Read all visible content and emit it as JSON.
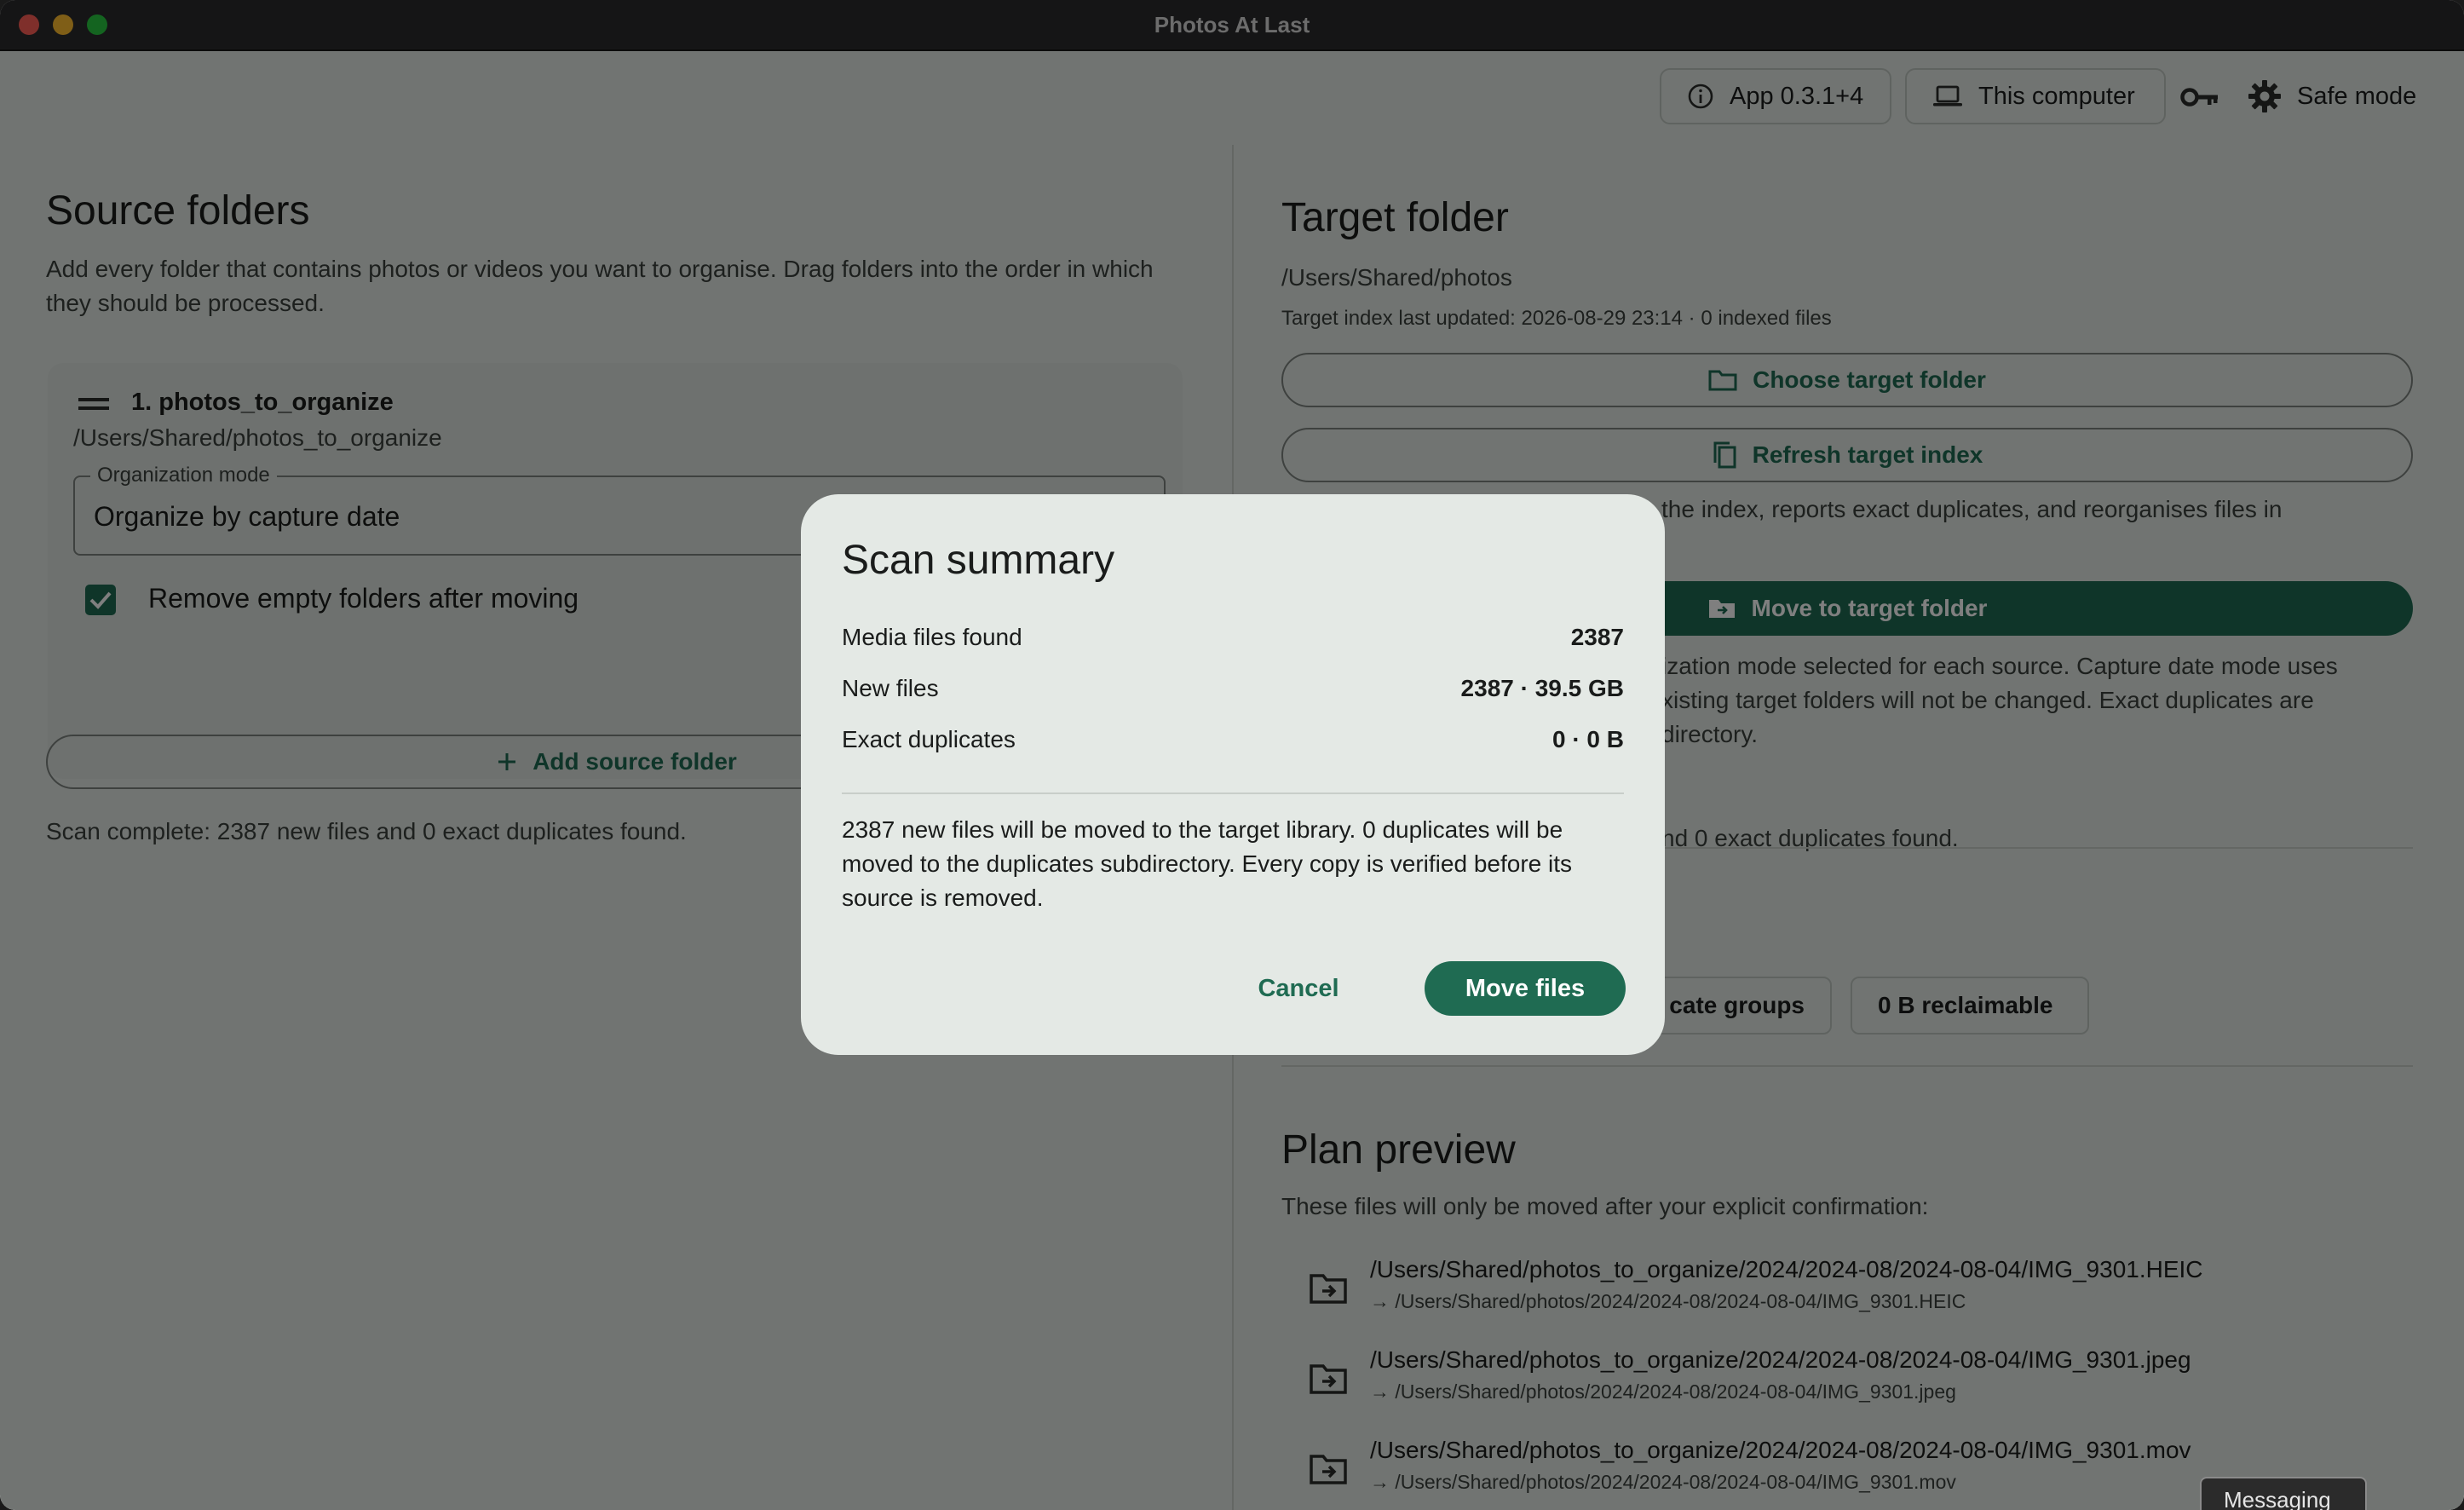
{
  "window": {
    "title": "Photos At Last"
  },
  "header": {
    "app_version": "App 0.3.1+4",
    "device": "This computer",
    "safe_mode": "Safe mode"
  },
  "source": {
    "title": "Source folders",
    "description": "Add every folder that contains photos or videos you want to organise. Drag folders into the order in which they should be processed.",
    "folder": {
      "name": "1. photos_to_organize",
      "path": "/Users/Shared/photos_to_organize",
      "mode_label": "Organization mode",
      "mode_value": "Organize by capture date",
      "remove_empty_label": "Remove empty folders after moving",
      "remove_empty_checked": true
    },
    "add_button": "Add source folder",
    "scan_status": "Scan complete: 2387 new files and 0 exact duplicates found."
  },
  "target": {
    "title": "Target folder",
    "path": "/Users/Shared/photos",
    "index_info": "Target index last updated: 2026-08-29 23:14 · 0 indexed files",
    "choose_button": "Choose target folder",
    "refresh_button": "Refresh target index",
    "scan_note": "the index, reports exact duplicates, and reorganises files in",
    "move_button": "Move to target folder",
    "mode_note_lines": [
      "ization mode selected for each source. Capture date mode uses",
      "xisting target folders will not be changed. Exact duplicates are",
      "directory."
    ],
    "duplicates_note": "nd 0 exact duplicates found.",
    "chip_groups": "cate groups",
    "chip_reclaimable": "0 B reclaimable"
  },
  "plan": {
    "title": "Plan preview",
    "subtitle": "These files will only be moved after your explicit confirmation:",
    "items": [
      {
        "src": "/Users/Shared/photos_to_organize/2024/2024-08/2024-08-04/IMG_9301.HEIC",
        "dst": "→ /Users/Shared/photos/2024/2024-08/2024-08-04/IMG_9301.HEIC"
      },
      {
        "src": "/Users/Shared/photos_to_organize/2024/2024-08/2024-08-04/IMG_9301.jpeg",
        "dst": "→ /Users/Shared/photos/2024/2024-08/2024-08-04/IMG_9301.jpeg"
      },
      {
        "src": "/Users/Shared/photos_to_organize/2024/2024-08/2024-08-04/IMG_9301.mov",
        "dst": "→ /Users/Shared/photos/2024/2024-08/2024-08-04/IMG_9301.mov"
      }
    ]
  },
  "dialog": {
    "title": "Scan summary",
    "rows": [
      {
        "label": "Media files found",
        "value": "2387"
      },
      {
        "label": "New files",
        "value": "2387 · 39.5 GB"
      },
      {
        "label": "Exact duplicates",
        "value": "0 · 0 B"
      }
    ],
    "message": "2387 new files will be moved to the target library. 0 duplicates will be moved to the duplicates subdirectory. Every copy is verified before its source is removed.",
    "cancel": "Cancel",
    "confirm": "Move files"
  },
  "tooltip": "Messaging",
  "colors": {
    "accent": "#1f6b52",
    "surface": "#e3e9e5",
    "dialog": "#e4e9e5"
  }
}
